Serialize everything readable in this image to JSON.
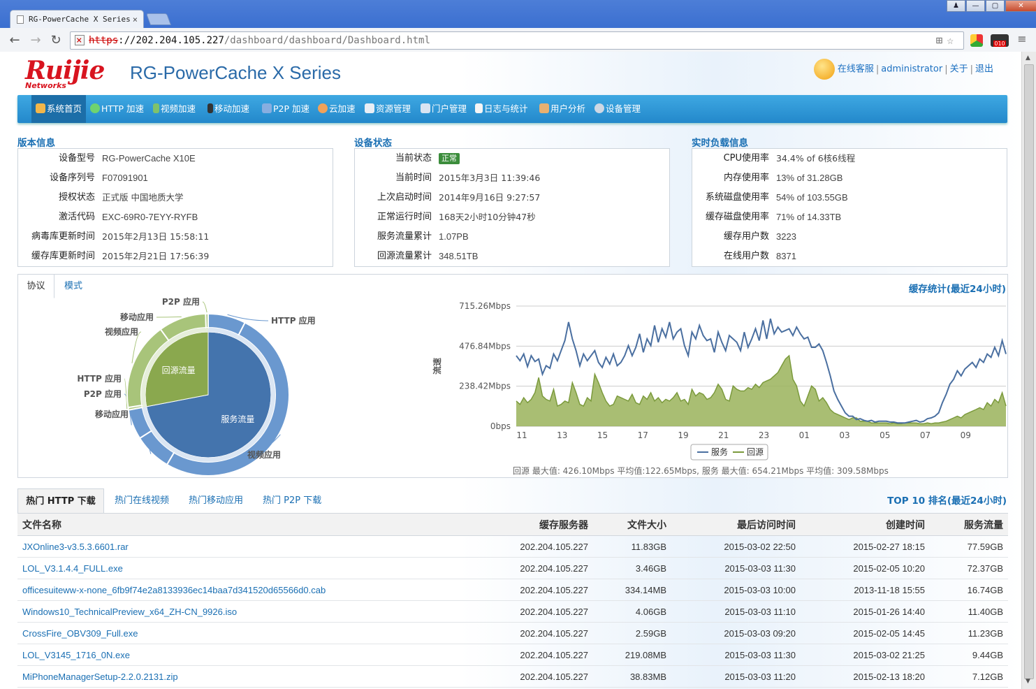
{
  "browser": {
    "tab_title": "RG-PowerCache X Series",
    "url_scheme": "https",
    "url_host": "://202.204.105.227",
    "url_path": "/dashboard/dashboard/Dashboard.html",
    "window_buttons": [
      "♟",
      "—",
      "▢",
      "✕"
    ],
    "ext_badge": "010"
  },
  "header": {
    "logo_text": "Ruijie",
    "logo_sub": "Networks",
    "brand": "RG-PowerCache X Series",
    "links": [
      "在线客服",
      "administrator",
      "关于",
      "退出"
    ]
  },
  "menu": [
    {
      "label": "系统首页",
      "icon": "home-icon",
      "color": "#f2b64a"
    },
    {
      "label": "HTTP 加速",
      "icon": "globe-icon",
      "color": "#6fd36f"
    },
    {
      "label": "视频加速",
      "icon": "film-icon",
      "color": "#7fc26b"
    },
    {
      "label": "移动加速",
      "icon": "mobile-icon",
      "color": "#333333"
    },
    {
      "label": "P2P 加速",
      "icon": "feather-icon",
      "color": "#88aee0"
    },
    {
      "label": "云加速",
      "icon": "cloud-icon",
      "color": "#f0a25a"
    },
    {
      "label": "资源管理",
      "icon": "folder-icon",
      "color": "#e9eef5"
    },
    {
      "label": "门户管理",
      "icon": "monitor-icon",
      "color": "#d8e4f2"
    },
    {
      "label": "日志与统计",
      "icon": "log-icon",
      "color": "#f5f5f5"
    },
    {
      "label": "用户分析",
      "icon": "users-icon",
      "color": "#e8b070"
    },
    {
      "label": "设备管理",
      "icon": "gear-icon",
      "color": "#cfd8e4"
    }
  ],
  "version_info": {
    "title": "版本信息",
    "rows": [
      {
        "k": "设备型号",
        "v": "RG-PowerCache X10E"
      },
      {
        "k": "设备序列号",
        "v": "F07091901"
      },
      {
        "k": "授权状态",
        "v": "正式版 中国地质大学"
      },
      {
        "k": "激活代码",
        "v": "EXC-69R0-7EYY-RYFB"
      },
      {
        "k": "病毒库更新时间",
        "v": "2015年2月13日 15:58:11"
      },
      {
        "k": "缓存库更新时间",
        "v": "2015年2月21日 17:56:39"
      }
    ]
  },
  "device_status": {
    "title": "设备状态",
    "status_key": "当前状态",
    "status_badge": "正常",
    "rows": [
      {
        "k": "当前时间",
        "v": "2015年3月3日 11:39:46"
      },
      {
        "k": "上次启动时间",
        "v": "2014年9月16日 9:27:57"
      },
      {
        "k": "正常运行时间",
        "v": "168天2小时10分钟47秒"
      },
      {
        "k": "服务流量累计",
        "v": "1.07PB"
      },
      {
        "k": "回源流量累计",
        "v": "348.51TB"
      }
    ]
  },
  "load_info": {
    "title": "实时负载信息",
    "rows": [
      {
        "k": "CPU使用率",
        "v": "34.4% of 6核6线程"
      },
      {
        "k": "内存使用率",
        "v": "13% of 31.28GB"
      },
      {
        "k": "系统磁盘使用率",
        "v": "54% of 103.55GB"
      },
      {
        "k": "缓存磁盘使用率",
        "v": "71% of 14.33TB"
      },
      {
        "k": "缓存用户数",
        "v": "3223"
      },
      {
        "k": "在线用户数",
        "v": "8371"
      }
    ]
  },
  "chart_panel": {
    "tabs": [
      "协议",
      "模式"
    ],
    "title": "缓存统计(最近24小时)",
    "summary": "回源 最大值: 426.10Mbps 平均值:122.65Mbps, 服务 最大值: 654.21Mbps 平均值: 309.58Mbps"
  },
  "chart_data": [
    {
      "type": "pie",
      "inner_labels": [
        "回源流量",
        "服务流量"
      ],
      "inner": [
        {
          "name": "回源流量",
          "value": 28,
          "color": "#8aa84e"
        },
        {
          "name": "服务流量",
          "value": 72,
          "color": "#4474ad"
        }
      ],
      "outer_labels": [
        "HTTP 应用",
        "视频应用",
        "移动应用",
        "P2P 应用",
        "HTTP 应用",
        "视频应用",
        "移动应用",
        "P2P 应用"
      ],
      "outer_values": [
        7.5,
        51,
        7.5,
        6,
        0.5,
        17.5,
        9.5,
        0.5
      ],
      "outer_colors": [
        "#6a98cf",
        "#6a98cf",
        "#6a98cf",
        "#6a98cf",
        "#a8c47a",
        "#a8c47a",
        "#a8c47a",
        "#a8c47a"
      ]
    },
    {
      "type": "area",
      "ylabel": "流速",
      "y_ticks": [
        "0bps",
        "238.42Mbps",
        "476.84Mbps",
        "715.26Mbps"
      ],
      "ylim": [
        0,
        715.26
      ],
      "x_ticks": [
        "11",
        "13",
        "15",
        "17",
        "19",
        "21",
        "23",
        "01",
        "03",
        "05",
        "07",
        "09"
      ],
      "series": [
        {
          "name": "服务",
          "color": "#4a6fa0",
          "values": [
            420,
            390,
            430,
            355,
            420,
            385,
            400,
            310,
            360,
            345,
            430,
            390,
            450,
            510,
            620,
            520,
            450,
            360,
            430,
            390,
            420,
            450,
            380,
            350,
            410,
            370,
            430,
            360,
            380,
            420,
            480,
            420,
            470,
            550,
            440,
            520,
            480,
            600,
            500,
            580,
            530,
            620,
            520,
            560,
            580,
            480,
            420,
            560,
            520,
            600,
            540,
            510,
            520,
            440,
            560,
            500,
            450,
            540,
            520,
            500,
            450,
            560,
            470,
            520,
            580,
            510,
            630,
            520,
            640,
            550,
            590,
            560,
            570,
            580,
            540,
            590,
            550,
            520,
            530,
            470,
            470,
            490,
            450,
            380,
            300,
            210,
            160,
            120,
            80,
            60,
            60,
            40,
            45,
            35,
            30,
            35,
            25,
            30,
            30,
            30,
            25,
            25,
            20,
            20,
            20,
            25,
            30,
            35,
            25,
            30,
            45,
            50,
            60,
            80,
            140,
            190,
            250,
            280,
            330,
            300,
            340,
            360,
            380,
            350,
            400,
            380,
            430,
            410,
            470,
            420,
            510,
            430
          ]
        },
        {
          "name": "回源",
          "color": "#7b9a3c",
          "values": [
            150,
            130,
            170,
            140,
            160,
            200,
            290,
            180,
            160,
            150,
            220,
            120,
            130,
            150,
            140,
            260,
            200,
            130,
            120,
            170,
            150,
            310,
            260,
            200,
            150,
            120,
            130,
            180,
            170,
            160,
            150,
            190,
            140,
            130,
            180,
            160,
            200,
            150,
            170,
            140,
            160,
            150,
            170,
            200,
            150,
            160,
            130,
            220,
            180,
            200,
            190,
            160,
            170,
            200,
            250,
            220,
            160,
            150,
            240,
            220,
            210,
            210,
            230,
            220,
            250,
            230,
            260,
            270,
            280,
            300,
            320,
            360,
            400,
            420,
            280,
            240,
            150,
            120,
            180,
            240,
            220,
            150,
            170,
            140,
            100,
            80,
            70,
            60,
            50,
            40,
            50,
            50,
            30,
            30,
            30,
            20,
            20,
            20,
            20,
            20,
            15,
            20,
            15,
            15,
            20,
            20,
            20,
            20,
            15,
            15,
            20,
            15,
            20,
            20,
            25,
            30,
            40,
            50,
            60,
            50,
            70,
            80,
            90,
            100,
            110,
            100,
            140,
            120,
            160,
            140,
            200,
            120
          ]
        }
      ],
      "legend": [
        "服务",
        "回源"
      ]
    }
  ],
  "downloads": {
    "tabs": [
      "热门 HTTP 下载",
      "热门在线视频",
      "热门移动应用",
      "热门 P2P 下载"
    ],
    "title": "TOP 10 排名(最近24小时)",
    "columns": [
      "文件名称",
      "缓存服务器",
      "文件大小",
      "最后访问时间",
      "创建时间",
      "服务流量"
    ],
    "rows": [
      [
        "JXOnline3-v3.5.3.6601.rar",
        "202.204.105.227",
        "11.83GB",
        "2015-03-02 22:50",
        "2015-02-27 18:15",
        "77.59GB"
      ],
      [
        "LOL_V3.1.4.4_FULL.exe",
        "202.204.105.227",
        "3.46GB",
        "2015-03-03 11:30",
        "2015-02-05 10:20",
        "72.37GB"
      ],
      [
        "officesuiteww-x-none_6fb9f74e2a8133936ec14baa7d341520d65566d0.cab",
        "202.204.105.227",
        "334.14MB",
        "2015-03-03 10:00",
        "2013-11-18 15:55",
        "16.74GB"
      ],
      [
        "Windows10_TechnicalPreview_x64_ZH-CN_9926.iso",
        "202.204.105.227",
        "4.06GB",
        "2015-03-03 11:10",
        "2015-01-26 14:40",
        "11.40GB"
      ],
      [
        "CrossFire_OBV309_Full.exe",
        "202.204.105.227",
        "2.59GB",
        "2015-03-03 09:20",
        "2015-02-05 14:45",
        "11.23GB"
      ],
      [
        "LOL_V3145_1716_0N.exe",
        "202.204.105.227",
        "219.08MB",
        "2015-03-03 11:30",
        "2015-03-02 21:25",
        "9.44GB"
      ],
      [
        "MiPhoneManagerSetup-2.2.0.2131.zip",
        "202.204.105.227",
        "38.83MB",
        "2015-03-03 11:20",
        "2015-02-13 18:20",
        "7.12GB"
      ]
    ]
  }
}
